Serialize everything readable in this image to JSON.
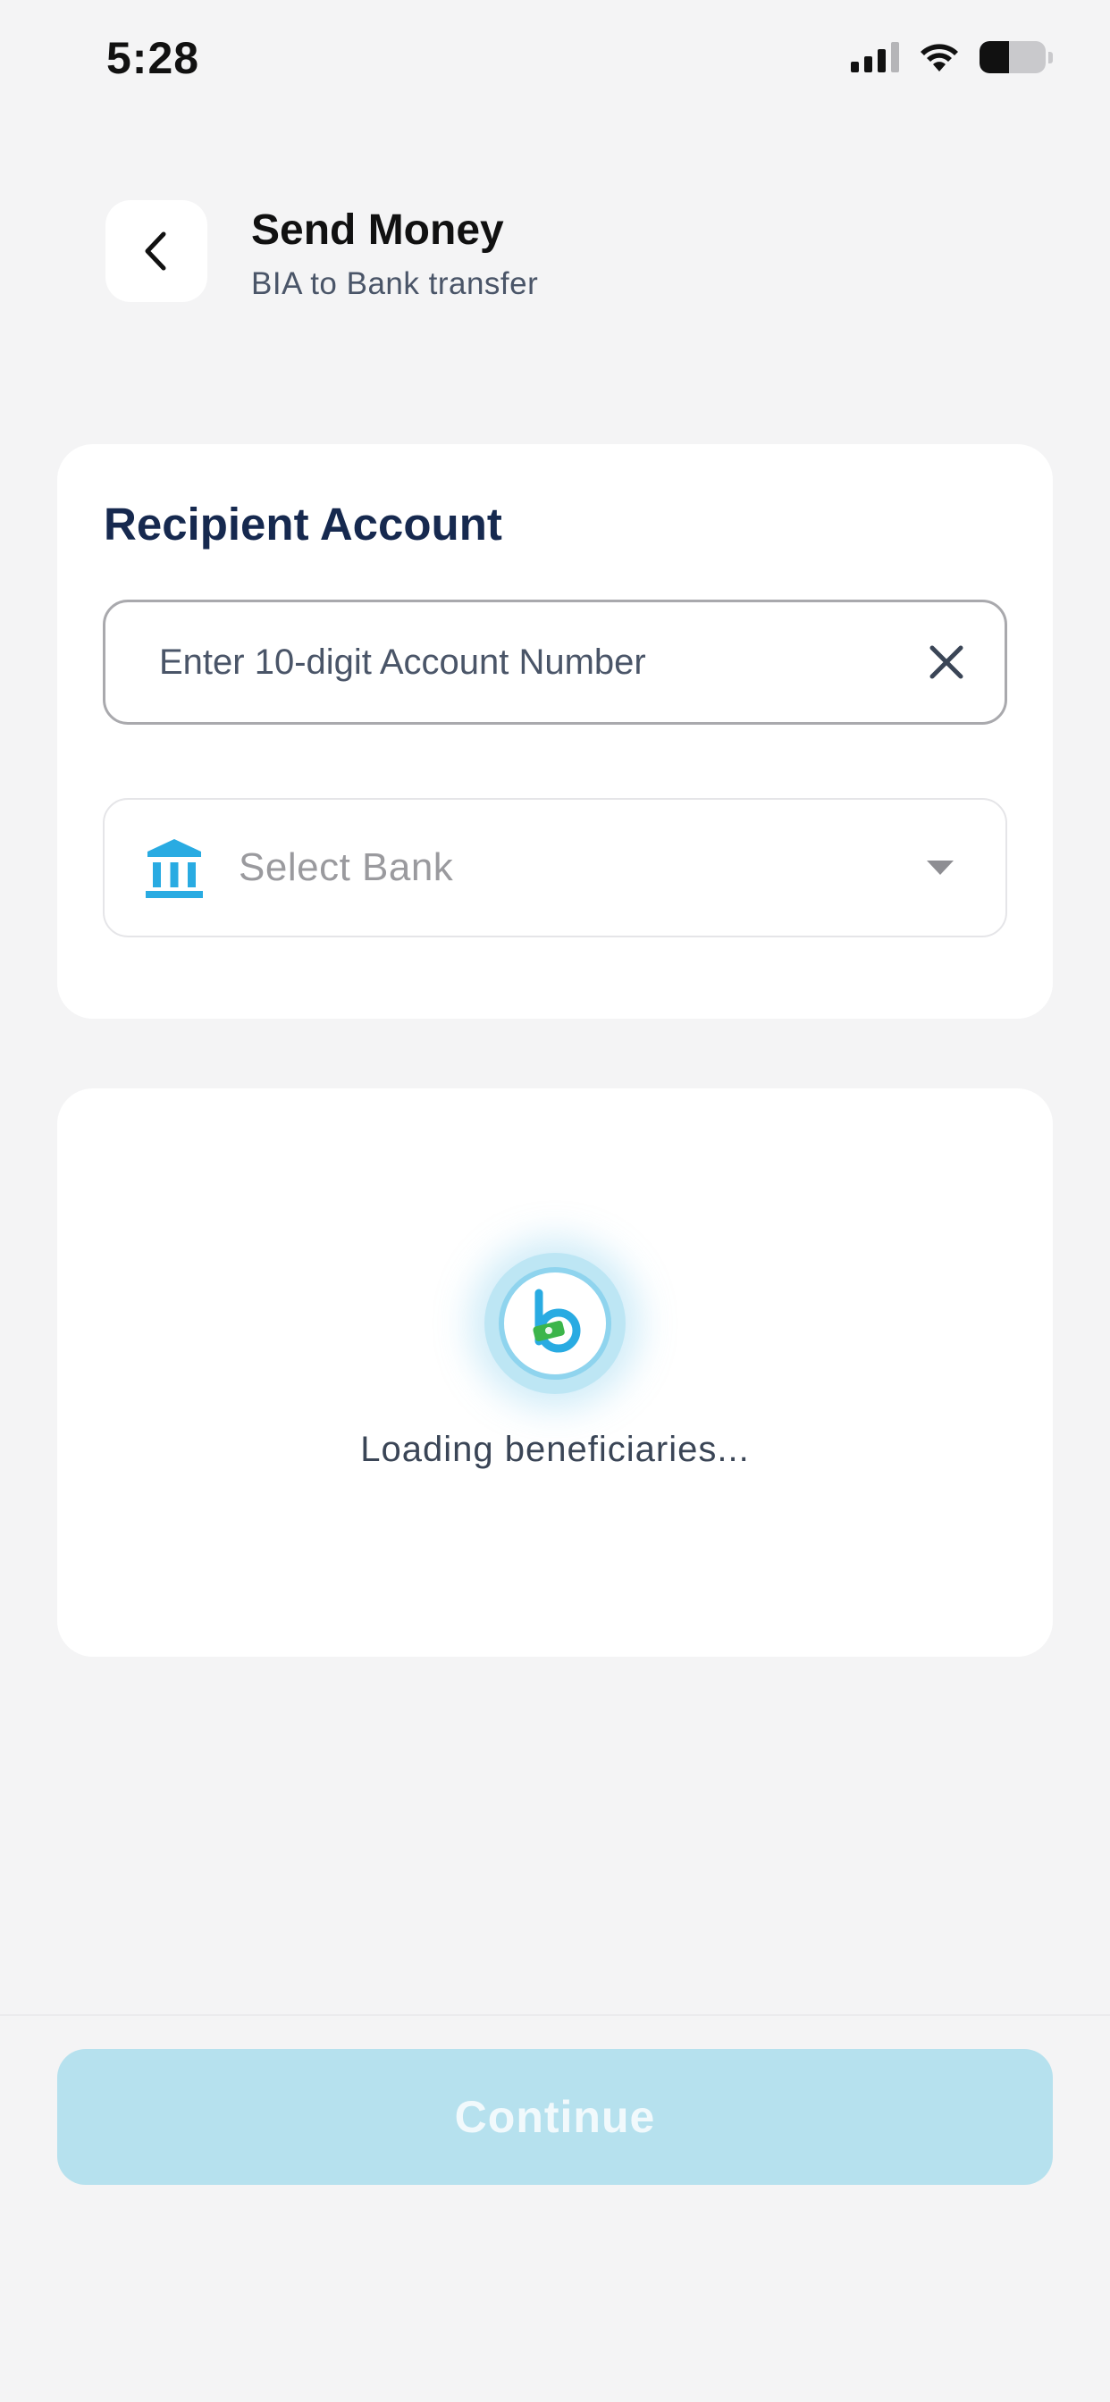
{
  "status_bar": {
    "time": "5:28",
    "battery_level": 0.45
  },
  "header": {
    "title": "Send Money",
    "subtitle": "BIA to Bank transfer",
    "back_icon": "chevron-left-icon"
  },
  "recipient": {
    "title": "Recipient Account",
    "account_placeholder": "Enter 10-digit Account Number",
    "account_value": "",
    "clear_icon": "close-icon",
    "bank_placeholder": "Select Bank",
    "bank_icon": "bank-icon",
    "dropdown_icon": "caret-down-icon"
  },
  "beneficiaries": {
    "loading_text": "Loading beneficiaries..."
  },
  "footer": {
    "continue_label": "Continue"
  },
  "colors": {
    "accent": "#29ABE2",
    "disabled_button": "#B6E1EE",
    "title_navy": "#16294F",
    "logo_green": "#3CB54A"
  }
}
